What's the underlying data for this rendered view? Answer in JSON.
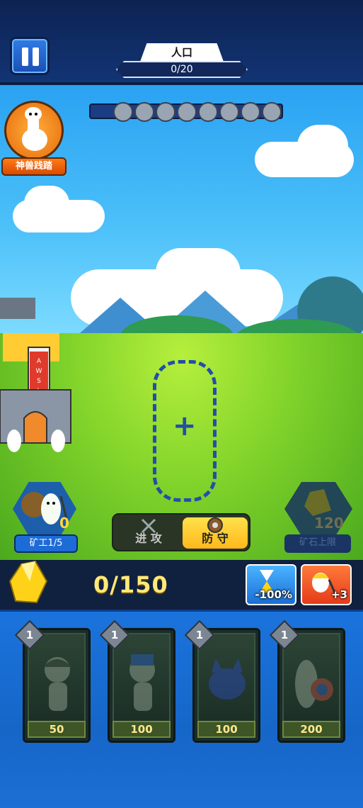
{
  "header": {
    "population_label": "人口",
    "population_value": "0/20"
  },
  "skill": {
    "label": "神兽践踏"
  },
  "wave": {
    "enemy_icons": 8
  },
  "miner": {
    "label": "矿工1/5",
    "count": "0"
  },
  "mode": {
    "attack_label": "进 攻",
    "defend_label": "防 守",
    "selected": "defend"
  },
  "ore_cap": {
    "label": "矿石上限",
    "value": "120"
  },
  "resources": {
    "ore_value": "0/150"
  },
  "boosts": {
    "time_label": "-100%",
    "miner_label": "+3"
  },
  "cards": [
    {
      "level": "1",
      "cost": "50",
      "icon": "helmet-soldier-icon"
    },
    {
      "level": "1",
      "cost": "100",
      "icon": "archer-icon"
    },
    {
      "level": "1",
      "cost": "100",
      "icon": "cat-icon"
    },
    {
      "level": "1",
      "cost": "200",
      "icon": "shield-knight-icon"
    }
  ],
  "colors": {
    "accent_yellow": "#ffe14a",
    "panel_blue": "#1a73dc",
    "ore_text": "#ffe97a"
  }
}
